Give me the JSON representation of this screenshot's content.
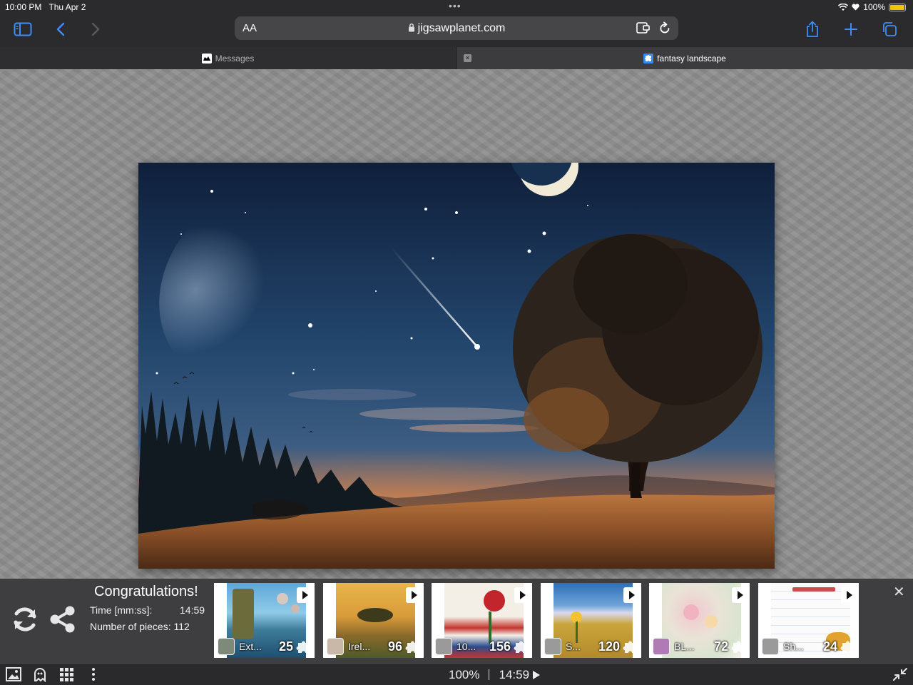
{
  "status": {
    "time": "10:00 PM",
    "date": "Thu Apr 2",
    "battery": "100%",
    "battery_level": 1.0,
    "battery_color": "#f5c400"
  },
  "toolbar": {
    "text_size_label": "AA",
    "url": "jigsawplanet.com",
    "accent": "#3d8ef7"
  },
  "tabs": [
    {
      "label": "Messages",
      "active": false
    },
    {
      "label": "fantasy landscape",
      "active": true
    }
  ],
  "puzzle": {
    "title": "fantasy landscape"
  },
  "completion": {
    "title": "Congratulations!",
    "time_label": "Time [mm:ss]:",
    "time_value": "14:59",
    "pieces_label": "Number of pieces:",
    "pieces_value": "112"
  },
  "suggestions": [
    {
      "name": "Ext...",
      "count": "25"
    },
    {
      "name": "Irel...",
      "count": "96"
    },
    {
      "name": "10...",
      "count": "156"
    },
    {
      "name": "S...",
      "count": "120"
    },
    {
      "name": "BL...",
      "count": "72"
    },
    {
      "name": "Sh...",
      "count": "24"
    }
  ],
  "bottombar": {
    "zoom": "100%",
    "timer": "14:59"
  }
}
